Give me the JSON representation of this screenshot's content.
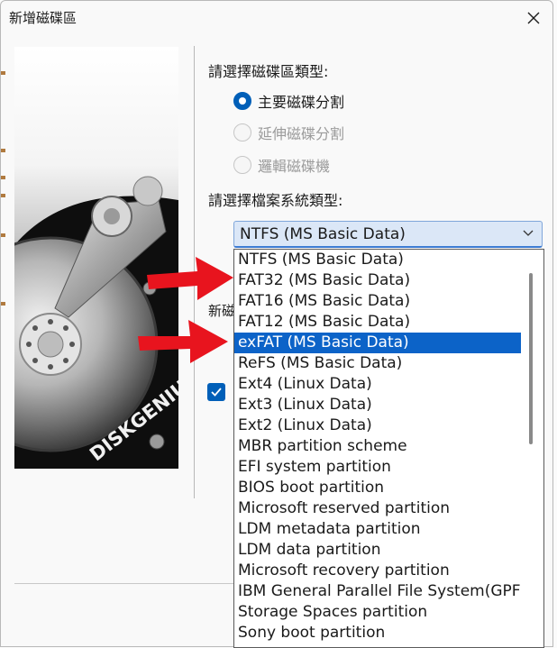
{
  "window": {
    "title": "新增磁碟區"
  },
  "partition_type": {
    "label": "請選擇磁碟區類型:",
    "options": [
      {
        "label": "主要磁碟分割",
        "checked": true,
        "enabled": true
      },
      {
        "label": "延伸磁碟分割",
        "checked": false,
        "enabled": false
      },
      {
        "label": "邏輯磁碟機",
        "checked": false,
        "enabled": false
      }
    ]
  },
  "filesystem": {
    "label": "請選擇檔案系統類型:",
    "selected": "NTFS (MS Basic Data)",
    "options": [
      "NTFS (MS Basic Data)",
      "FAT32 (MS Basic Data)",
      "FAT16 (MS Basic Data)",
      "FAT12 (MS Basic Data)",
      "exFAT (MS Basic Data)",
      "ReFS (MS Basic Data)",
      "Ext4 (Linux Data)",
      "Ext3 (Linux Data)",
      "Ext2 (Linux Data)",
      "MBR partition scheme",
      "EFI system partition",
      "BIOS boot partition",
      "Microsoft reserved partition",
      "LDM metadata partition",
      "LDM data partition",
      "Microsoft recovery partition",
      "IBM General Parallel File System(GPF",
      "Storage Spaces partition",
      "Sony boot partition"
    ],
    "highlighted_index": 4
  },
  "hidden_label_partial": "新磁",
  "checkbox": {
    "checked": true
  },
  "logo_text": "DISKGENIUS",
  "colors": {
    "accent": "#005fb8",
    "highlight": "#0c63c8",
    "annotation_arrow": "#e8141e"
  }
}
